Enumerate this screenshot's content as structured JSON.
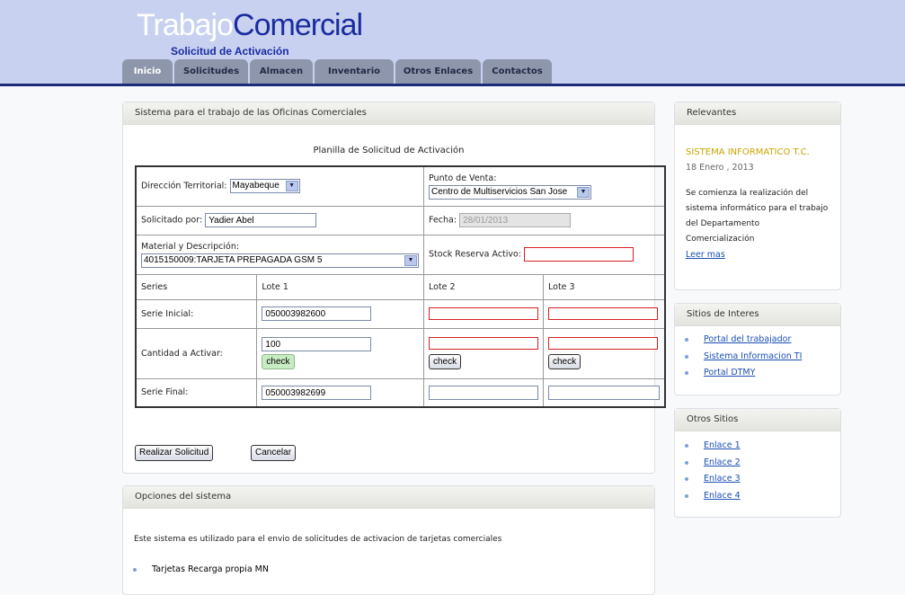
{
  "header": {
    "logo_part1": "Trabajo",
    "logo_part2": "Comercial",
    "subtitle": "Solicitud de Activación"
  },
  "nav": {
    "tabs": [
      "Inicio",
      "Solicitudes",
      "Almacen",
      "Inventario",
      "Otros Enlaces",
      "Contactos"
    ],
    "active": "Inicio"
  },
  "main_panel": {
    "title": "Sistema para el trabajo de las Oficinas Comerciales",
    "form_title": "Planilla de Solicitud de Activación",
    "direccion_label": "Dirección Territorial:",
    "direccion_value": "Mayabeque",
    "punto_label": "Punto de Venta:",
    "punto_value": "Centro de Multiservicios San Jose",
    "solicitado_label": "Solicitado por:",
    "solicitado_value": "Yadier Abel",
    "fecha_label": "Fecha:",
    "fecha_value": "28/01/2013",
    "material_label": "Material y Descripción:",
    "material_value": "4015150009:TARJETA PREPAGADA GSM 5",
    "stock_label": "Stock Reserva Activo:",
    "stock_value": "",
    "series_header": "Series",
    "lote_headers": [
      "Lote 1",
      "Lote 2",
      "Lote 3"
    ],
    "serie_inicial_label": "Serie Inicial:",
    "serie_inicial_values": [
      "050003982600",
      "",
      ""
    ],
    "cantidad_label": "Cantidad a Activar:",
    "cantidad_values": [
      "100",
      "",
      ""
    ],
    "check_label": "check",
    "serie_final_label": "Serie Final:",
    "serie_final_values": [
      "050003982699",
      "",
      ""
    ],
    "submit_label": "Realizar Solicitud",
    "cancel_label": "Cancelar"
  },
  "options_panel": {
    "title": "Opciones del sistema",
    "description": "Este sistema es utilizado para el envio de solicitudes de activacion de tarjetas comerciales",
    "items": [
      "Tarjetas Recarga propia MN"
    ]
  },
  "relevantes": {
    "title": "Relevantes",
    "headline": "SISTEMA INFORMATICO T.C.",
    "date": "18 Enero , 2013",
    "body": "Se comienza la realización del sistema informático para el trabajo del Departamento Comercialización",
    "read_more": "Leer mas"
  },
  "sitios": {
    "title": "Sitios de Interes",
    "links": [
      "Portal del trabajador",
      "Sistema Informacion TI",
      "Portal DTMY"
    ]
  },
  "otros": {
    "title": "Otros Sitios",
    "links": [
      "Enlace 1",
      "Enlace 2",
      "Enlace 3",
      "Enlace 4"
    ]
  },
  "colors": {
    "header_bg": "#c8d2f0",
    "brand_blue": "#1a2ba0",
    "tab_bg": "#8d96ab",
    "headline_yellow": "#c8a400",
    "error_red": "#d62020"
  }
}
